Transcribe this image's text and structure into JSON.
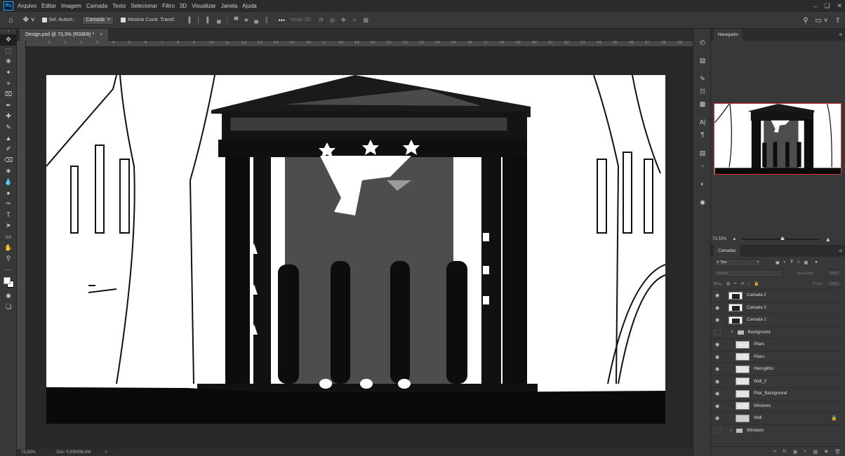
{
  "menu": {
    "app_logo": "Ps",
    "items": [
      "Arquivo",
      "Editar",
      "Imagem",
      "Camada",
      "Texto",
      "Selecionar",
      "Filtro",
      "3D",
      "Visualizar",
      "Janela",
      "Ajuda"
    ],
    "window_controls": [
      "minimize-icon",
      "restore-icon",
      "close-icon"
    ]
  },
  "options": {
    "auto_select_label": "Sel. Autom.:",
    "auto_select_value": "Camada",
    "show_transform_label": "Mostrar Contr. Transf.",
    "mode_3d_label": "Modo 3D:",
    "more": "•••"
  },
  "document": {
    "tab_title": "Design.psd @ 73,3% (RGB/8) *",
    "ruler_numbers": [
      "0",
      "1",
      "2",
      "3",
      "4",
      "5",
      "6",
      "7",
      "8",
      "9",
      "10",
      "11",
      "12",
      "13",
      "14",
      "15",
      "16",
      "17",
      "18",
      "19",
      "20",
      "21",
      "22",
      "23",
      "24",
      "25",
      "26",
      "27",
      "28",
      "29",
      "30",
      "31",
      "32",
      "33",
      "34",
      "35",
      "36",
      "37",
      "38",
      "39"
    ],
    "zoom": "73,33%",
    "doc_size": "Doc: 5,93M/98,6M",
    "arrow": ">"
  },
  "navigator": {
    "title": "Navegador",
    "zoom": "73,33%",
    "zoom_fraction": 0.52
  },
  "layers": {
    "title": "Camadas",
    "filter_label": "Tipo",
    "blend_mode": "Normal",
    "opacity_label": "Opacidade:",
    "opacity_value": "100%",
    "lock_label": "Bloq.:",
    "fill_label": "Preen.:",
    "fill_value": "100%",
    "items": [
      {
        "name": "Camada 2",
        "visible": true,
        "type": "pixel",
        "indent": 0
      },
      {
        "name": "Camada 3",
        "visible": true,
        "type": "pixel",
        "indent": 0
      },
      {
        "name": "Camada 1",
        "visible": true,
        "type": "pixel",
        "indent": 0
      },
      {
        "name": "Background",
        "visible": false,
        "type": "group-open",
        "indent": 0
      },
      {
        "name": "Pilars",
        "visible": true,
        "type": "pixel",
        "indent": 1
      },
      {
        "name": "Pilars",
        "visible": true,
        "type": "pixel",
        "indent": 1
      },
      {
        "name": "Hieroglifos",
        "visible": true,
        "type": "pixel",
        "indent": 1
      },
      {
        "name": "Wall_2",
        "visible": true,
        "type": "pixel",
        "indent": 1
      },
      {
        "name": "Pilar_Background",
        "visible": true,
        "type": "pixel",
        "indent": 1
      },
      {
        "name": "Windows",
        "visible": true,
        "type": "pixel",
        "indent": 1
      },
      {
        "name": "Wall",
        "visible": true,
        "type": "fill",
        "indent": 1,
        "locked": true
      },
      {
        "name": "Windows",
        "visible": false,
        "type": "group-closed",
        "indent": 0
      }
    ]
  },
  "colors": {
    "app_bg": "#282828",
    "panel_bg": "#383838",
    "accent_red": "#d33333"
  }
}
